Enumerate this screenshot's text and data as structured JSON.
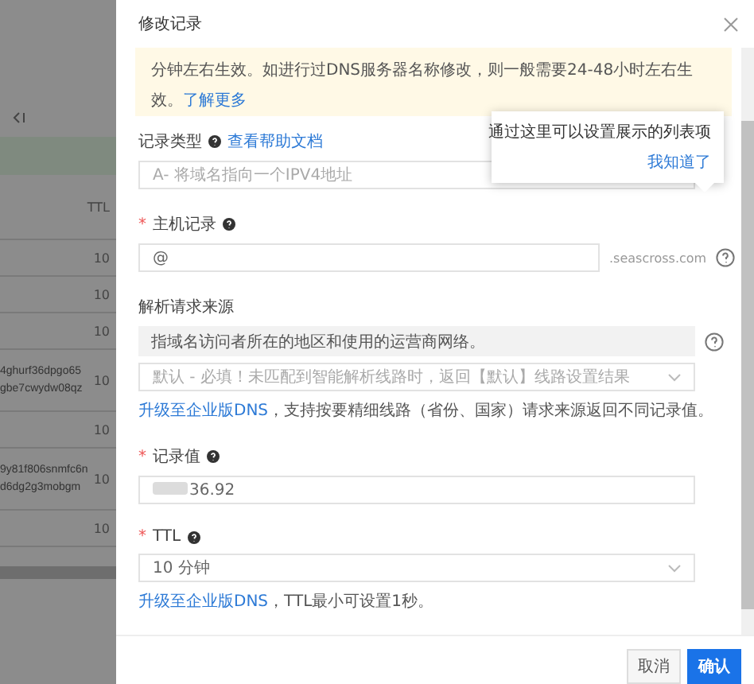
{
  "background": {
    "table": {
      "header": "TTL",
      "rows": [
        {
          "lines": [],
          "ttl": "10"
        },
        {
          "lines": [],
          "ttl": "10"
        },
        {
          "lines": [],
          "ttl": "10"
        },
        {
          "lines": [
            "4ghurf36dpgo65",
            "gbe7cwydw08qz"
          ],
          "ttl": "10"
        },
        {
          "lines": [],
          "ttl": "10"
        },
        {
          "lines": [
            "9y81f806snmfc6n",
            "d6dg2g3mobgm"
          ],
          "ttl": "10"
        },
        {
          "lines": [],
          "ttl": "10"
        }
      ]
    }
  },
  "dialog": {
    "title": "修改记录",
    "notice": {
      "text": "分钟左右生效。如进行过DNS服务器名称修改，则一般需要24-48小时左右生效。",
      "link": "了解更多"
    },
    "fields": [
      {
        "kind": "select",
        "label": "记录类型",
        "help": true,
        "link": "查看帮助文档",
        "value": "A- 将域名指向一个IPV4地址",
        "disabled": true,
        "side_help": false
      },
      {
        "kind": "input",
        "label": "主机记录",
        "required_mark": "*",
        "help": true,
        "value": "@",
        "suffix": ".seascross.com",
        "disabled": false,
        "side_help": true
      },
      {
        "kind": "line",
        "label": "解析请求来源",
        "help": false,
        "description": "指域名访问者所在的地区和使用的运营商网络。",
        "value": "默认 - 必填！未匹配到智能解析线路时，返回【默认】线路设置结果",
        "disabled": true,
        "side_help": true,
        "hint_link": "升级至企业版DNS",
        "hint": "，支持按要精细线路（省份、国家）请求来源返回不同记录值。"
      },
      {
        "kind": "input",
        "label": "记录值",
        "required_mark": "*",
        "help": true,
        "value": "36.92",
        "redacted": true,
        "disabled": false,
        "side_help": false
      },
      {
        "kind": "select",
        "label": "TTL",
        "required_mark": "*",
        "help": true,
        "value": "10 分钟",
        "disabled": false,
        "side_help": false,
        "hint_link": "升级至企业版DNS",
        "hint": "，TTL最小可设置1秒。"
      }
    ],
    "tooltip": {
      "text": "通过这里可以设置展示的列表项",
      "action": "我知道了"
    },
    "buttons": [
      {
        "label": "取消",
        "primary": false
      },
      {
        "label": "确认",
        "primary": true
      }
    ]
  }
}
